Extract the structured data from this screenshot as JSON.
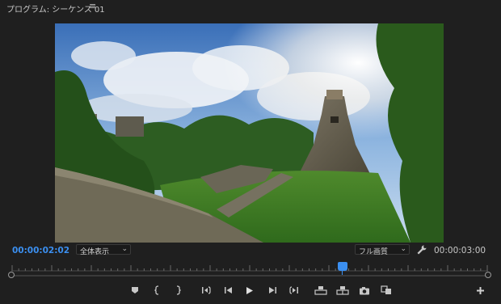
{
  "panel": {
    "title": "プログラム: シーケンス 01",
    "menu_icon": "hamburger-menu-icon"
  },
  "timecode": {
    "current": "00:00:02:02",
    "duration": "00:00:03:00"
  },
  "zoom_select": {
    "value": "全体表示"
  },
  "quality_select": {
    "value": "フル画質"
  },
  "playback": {
    "playhead_fraction": 0.68
  },
  "controls": [
    "add-marker-icon",
    "mark-in-icon",
    "mark-out-icon",
    "go-to-in-icon",
    "step-back-icon",
    "play-icon",
    "step-forward-icon",
    "go-to-out-icon",
    "lift-icon",
    "extract-icon",
    "export-frame-icon",
    "comparison-view-icon",
    "add-button-icon"
  ],
  "colors": {
    "accent": "#3b8ff0",
    "background": "#1f1f1f"
  }
}
